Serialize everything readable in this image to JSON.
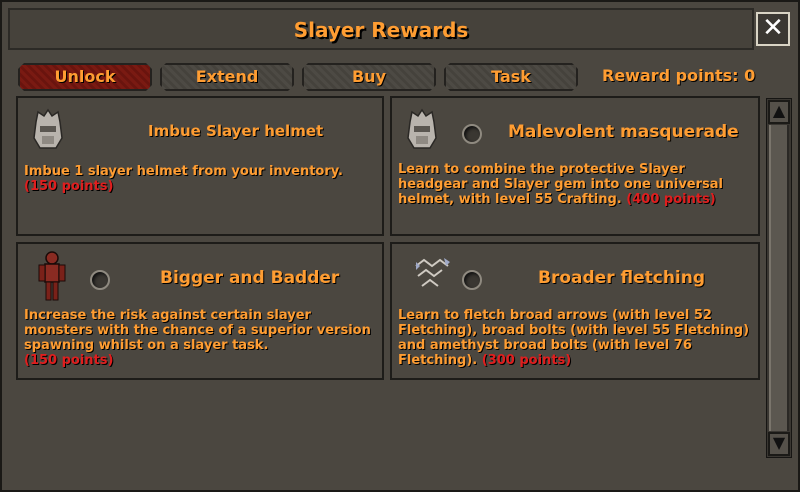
{
  "window": {
    "title": "Slayer Rewards",
    "close_label": "✕"
  },
  "tabs": [
    {
      "label": "Unlock",
      "active": true
    },
    {
      "label": "Extend",
      "active": false
    },
    {
      "label": "Buy",
      "active": false
    },
    {
      "label": "Task",
      "active": false
    }
  ],
  "reward_points": "Reward points: 0",
  "rewards": [
    {
      "title": "Imbue Slayer helmet",
      "description": "Imbue 1 slayer helmet from your inventory.",
      "cost": "(150 points)",
      "icon": "slayer-helmet-icon",
      "has_radio": false
    },
    {
      "title": "Malevolent masquerade",
      "description": "Learn to combine the protective Slayer headgear and Slayer gem into one universal helmet, with level 55 Crafting.",
      "cost": "(400 points)",
      "icon": "slayer-helmet-icon",
      "has_radio": true
    },
    {
      "title": "Bigger and Badder",
      "description": "Increase the risk against certain slayer monsters with the chance of a superior version spawning whilst on a slayer task.",
      "cost": "(150 points)",
      "icon": "monster-figure-icon",
      "has_radio": true
    },
    {
      "title": "Broader fletching",
      "description": "Learn to fletch broad arrows (with level 52 Fletching), broad bolts (with level 55 Fletching) and amethyst broad bolts (with level 76 Fletching).",
      "cost": "(300 points)",
      "icon": "broad-arrows-icon",
      "has_radio": true
    }
  ],
  "scrollbar": {
    "up_label": "▲",
    "down_label": "▼"
  },
  "colors": {
    "text": "#ff9d32",
    "cost": "#e01e1e",
    "active_tab": "#7a1a12",
    "panel": "#4b4740"
  }
}
